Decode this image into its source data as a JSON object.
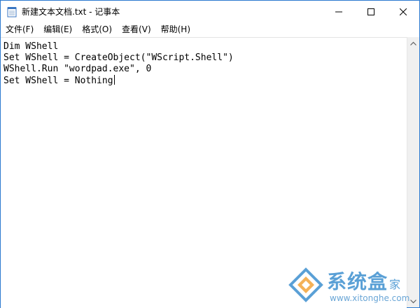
{
  "window": {
    "title": "新建文本文档.txt - 记事本"
  },
  "window_controls": {
    "minimize": "minimize",
    "maximize": "maximize",
    "close": "close"
  },
  "menu": {
    "items": [
      {
        "label": "文件(F)"
      },
      {
        "label": "编辑(E)"
      },
      {
        "label": "格式(O)"
      },
      {
        "label": "查看(V)"
      },
      {
        "label": "帮助(H)"
      }
    ]
  },
  "editor": {
    "lines": [
      "Dim WShell",
      "Set WShell = CreateObject(\"WScript.Shell\")",
      "WShell.Run \"wordpad.exe\", 0",
      "Set WShell = Nothing"
    ]
  },
  "watermark": {
    "title": "系统盒",
    "suffix": "家",
    "url": "www.xitonghe.com"
  },
  "colors": {
    "accent": "#2b79d0",
    "watermark": "#5aa0d6",
    "scrollbar": "#f0f0f0"
  }
}
